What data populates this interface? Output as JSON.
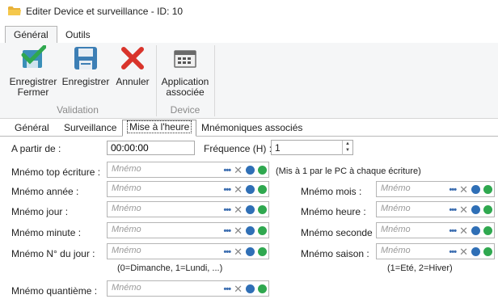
{
  "window": {
    "title": "Editer Device et surveillance - ID: 10",
    "icon": "folder-icon"
  },
  "ribbon": {
    "tabs": [
      "Général",
      "Outils"
    ],
    "active_tab": "Général",
    "groups": [
      {
        "label": "Validation",
        "buttons": [
          {
            "label_line1": "Enregistrer",
            "label_line2": "Fermer",
            "icon": "save-close-icon"
          },
          {
            "label_line1": "Enregistrer",
            "label_line2": "",
            "icon": "floppy-icon"
          },
          {
            "label_line1": "Annuler",
            "label_line2": "",
            "icon": "cancel-x-icon"
          }
        ]
      },
      {
        "label": "Device",
        "buttons": [
          {
            "label_line1": "Application",
            "label_line2": "associée",
            "icon": "app-window-icon"
          }
        ]
      }
    ]
  },
  "tabs": [
    "Général",
    "Surveillance",
    "Mise à l'heure",
    "Mnémoniques associés"
  ],
  "active_tab": "Mise à l'heure",
  "form": {
    "start_label": "A partir de :",
    "start_value": "00:00:00",
    "freq_label": "Fréquence (H) :",
    "freq_value": "1",
    "placeholder": "Mnémo",
    "top_label": "Mnémo top écriture :",
    "top_hint": "(Mis à 1 par le PC à chaque écriture)",
    "annee_label": "Mnémo année :",
    "mois_label": "Mnémo mois :",
    "jour_label": "Mnémo jour :",
    "heure_label": "Mnémo heure :",
    "minute_label": "Mnémo minute :",
    "seconde_label": "Mnémo seconde :",
    "njour_label": "Mnémo N° du jour :",
    "njour_hint": "(0=Dimanche, 1=Lundi, ...)",
    "saison_label": "Mnémo saison :",
    "saison_hint": "(1=Eté, 2=Hiver)",
    "quantieme_label": "Mnémo quantième :"
  },
  "colors": {
    "accent_blue": "#2f6fb6",
    "green": "#2fa84f",
    "red": "#d9342b"
  }
}
